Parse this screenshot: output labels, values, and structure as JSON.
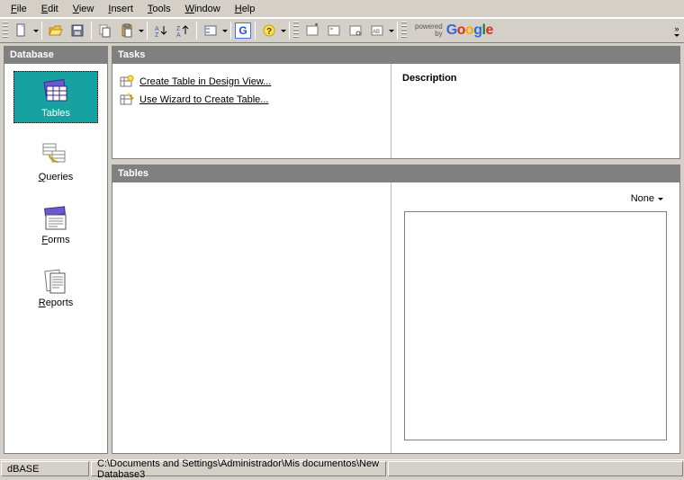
{
  "menu": {
    "file": "File",
    "edit": "Edit",
    "view": "View",
    "insert": "Insert",
    "tools": "Tools",
    "window": "Window",
    "help": "Help"
  },
  "google": {
    "powered": "powered",
    "by": "by"
  },
  "sidebar": {
    "title": "Database",
    "items": [
      {
        "label": "Tables"
      },
      {
        "label": "Queries"
      },
      {
        "label": "Forms"
      },
      {
        "label": "Reports"
      }
    ]
  },
  "tasks": {
    "title": "Tasks",
    "items": [
      {
        "label": "Create Table in Design View..."
      },
      {
        "label": "Use Wizard to Create Table..."
      }
    ],
    "description_label": "Description"
  },
  "tables": {
    "title": "Tables",
    "preview_mode": "None"
  },
  "status": {
    "db_type": "dBASE",
    "path": "C:\\Documents and Settings\\Administrador\\Mis documentos\\New Database3"
  }
}
